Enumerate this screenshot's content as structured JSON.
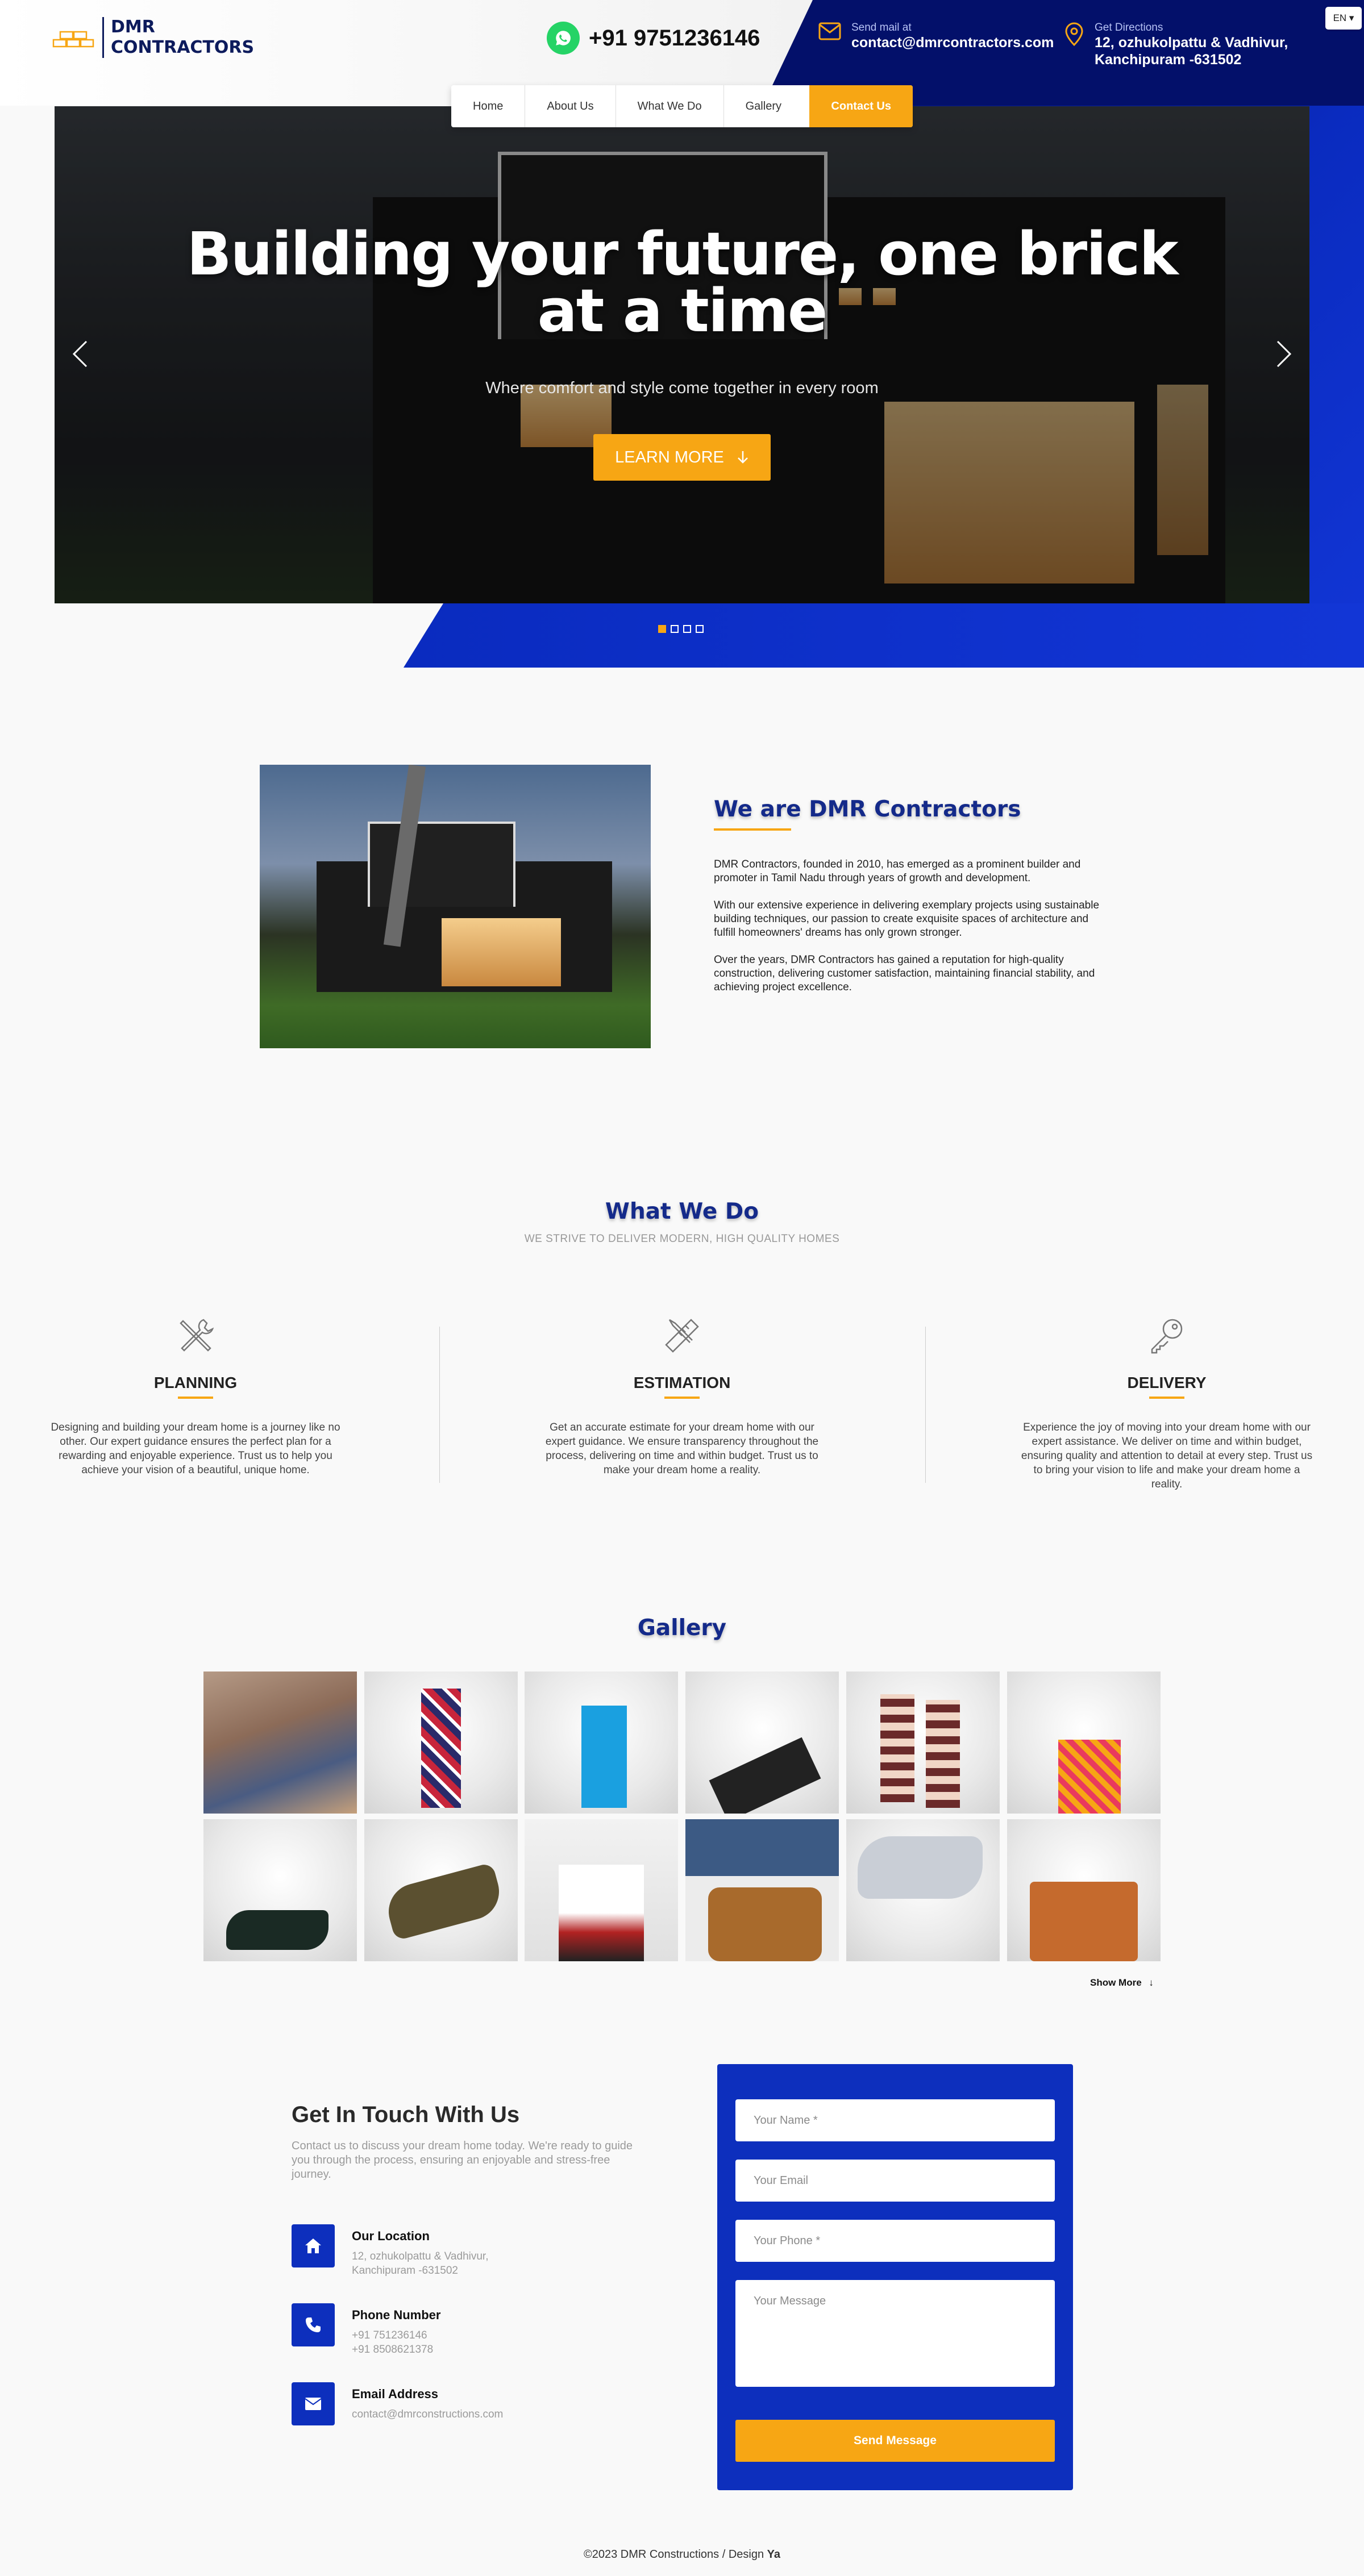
{
  "header": {
    "logo_line1": "DMR",
    "logo_line2": "CONTRACTORS",
    "phone": "+91 9751236146",
    "mail_label": "Send mail at",
    "mail_value": "contact@dmrcontractors.com",
    "dir_label": "Get Directions",
    "dir_line1": "12, ozhukolpattu & Vadhivur,",
    "dir_line2": "Kanchipuram -631502",
    "language": "EN ▾"
  },
  "nav": {
    "items": [
      "Home",
      "About Us",
      "What We Do",
      "Gallery"
    ],
    "cta": "Contact Us"
  },
  "hero": {
    "title_line1": "Building your future, one brick",
    "title_line2": "at a time",
    "subtitle": "Where comfort and style come together in every room",
    "button": "LEARN MORE",
    "prev_icon": "chevron-left-icon",
    "next_icon": "chevron-right-icon",
    "slide_count": 4,
    "active_slide": 1
  },
  "about": {
    "title": "We are DMR Contractors",
    "paragraphs": [
      "DMR Contractors, founded in 2010, has emerged as a prominent builder and promoter in Tamil Nadu through years of growth and development.",
      "With our extensive experience in delivering exemplary projects using sustainable building techniques, our passion to create exquisite spaces of architecture and fulfill homeowners' dreams has only grown stronger.",
      "Over the years, DMR Contractors has gained a reputation for high-quality construction, delivering customer satisfaction, maintaining financial stability, and achieving project excellence."
    ]
  },
  "services": {
    "title": "What We Do",
    "subtitle": "WE STRIVE TO DELIVER MODERN, HIGH QUALITY HOMES",
    "items": [
      {
        "title": "PLANNING",
        "icon": "tools-icon",
        "text": "Designing and building your dream home is a journey like no other. Our expert guidance ensures the perfect plan for a rewarding and enjoyable experience. Trust us to help you achieve your vision of a beautiful, unique home."
      },
      {
        "title": "ESTIMATION",
        "icon": "pencil-ruler-icon",
        "text": "Get an accurate estimate for your dream home with our expert guidance. We ensure transparency throughout the process, delivering on time and within budget. Trust us to make your dream home a reality."
      },
      {
        "title": "DELIVERY",
        "icon": "key-icon",
        "text": "Experience the joy of moving into your dream home with our expert assistance. We deliver on time and within budget, ensuring quality and attention to detail at every step. Trust us to bring your vision to life and make your dream home a reality."
      }
    ]
  },
  "gallery": {
    "title": "Gallery",
    "tiles": [
      "group-photo",
      "checkered-socks",
      "blue-socks",
      "sock-pack",
      "patterned-socks",
      "striped-socks",
      "black-sneakers",
      "olive-sneakers",
      "red-sneakers-legs",
      "tan-boots",
      "grey-sneaker",
      "leather-bag"
    ],
    "show_more": "Show More"
  },
  "contact": {
    "title": "Get In Touch With Us",
    "description": "Contact us to discuss your dream home today. We're ready to guide you through the process, ensuring an enjoyable and stress-free journey.",
    "location_label": "Our Location",
    "location_line1": "12, ozhukolpattu & Vadhivur,",
    "location_line2": "Kanchipuram -631502",
    "phone_label": "Phone Number",
    "phone_line1": "+91 751236146",
    "phone_line2": "+91 8508621378",
    "email_label": "Email Address",
    "email_value": "contact@dmrconstructions.com",
    "form": {
      "name_placeholder": "Your Name *",
      "email_placeholder": "Your Email",
      "phone_placeholder": "Your Phone *",
      "message_placeholder": "Your Message",
      "submit": "Send Message"
    }
  },
  "footer": {
    "text": "©2023 DMR Constructions / Design ",
    "brand": "Ya"
  },
  "colors": {
    "accent": "#f7a614",
    "brand_blue": "#0d2fbd",
    "dark_navy": "#0d1b5c"
  }
}
